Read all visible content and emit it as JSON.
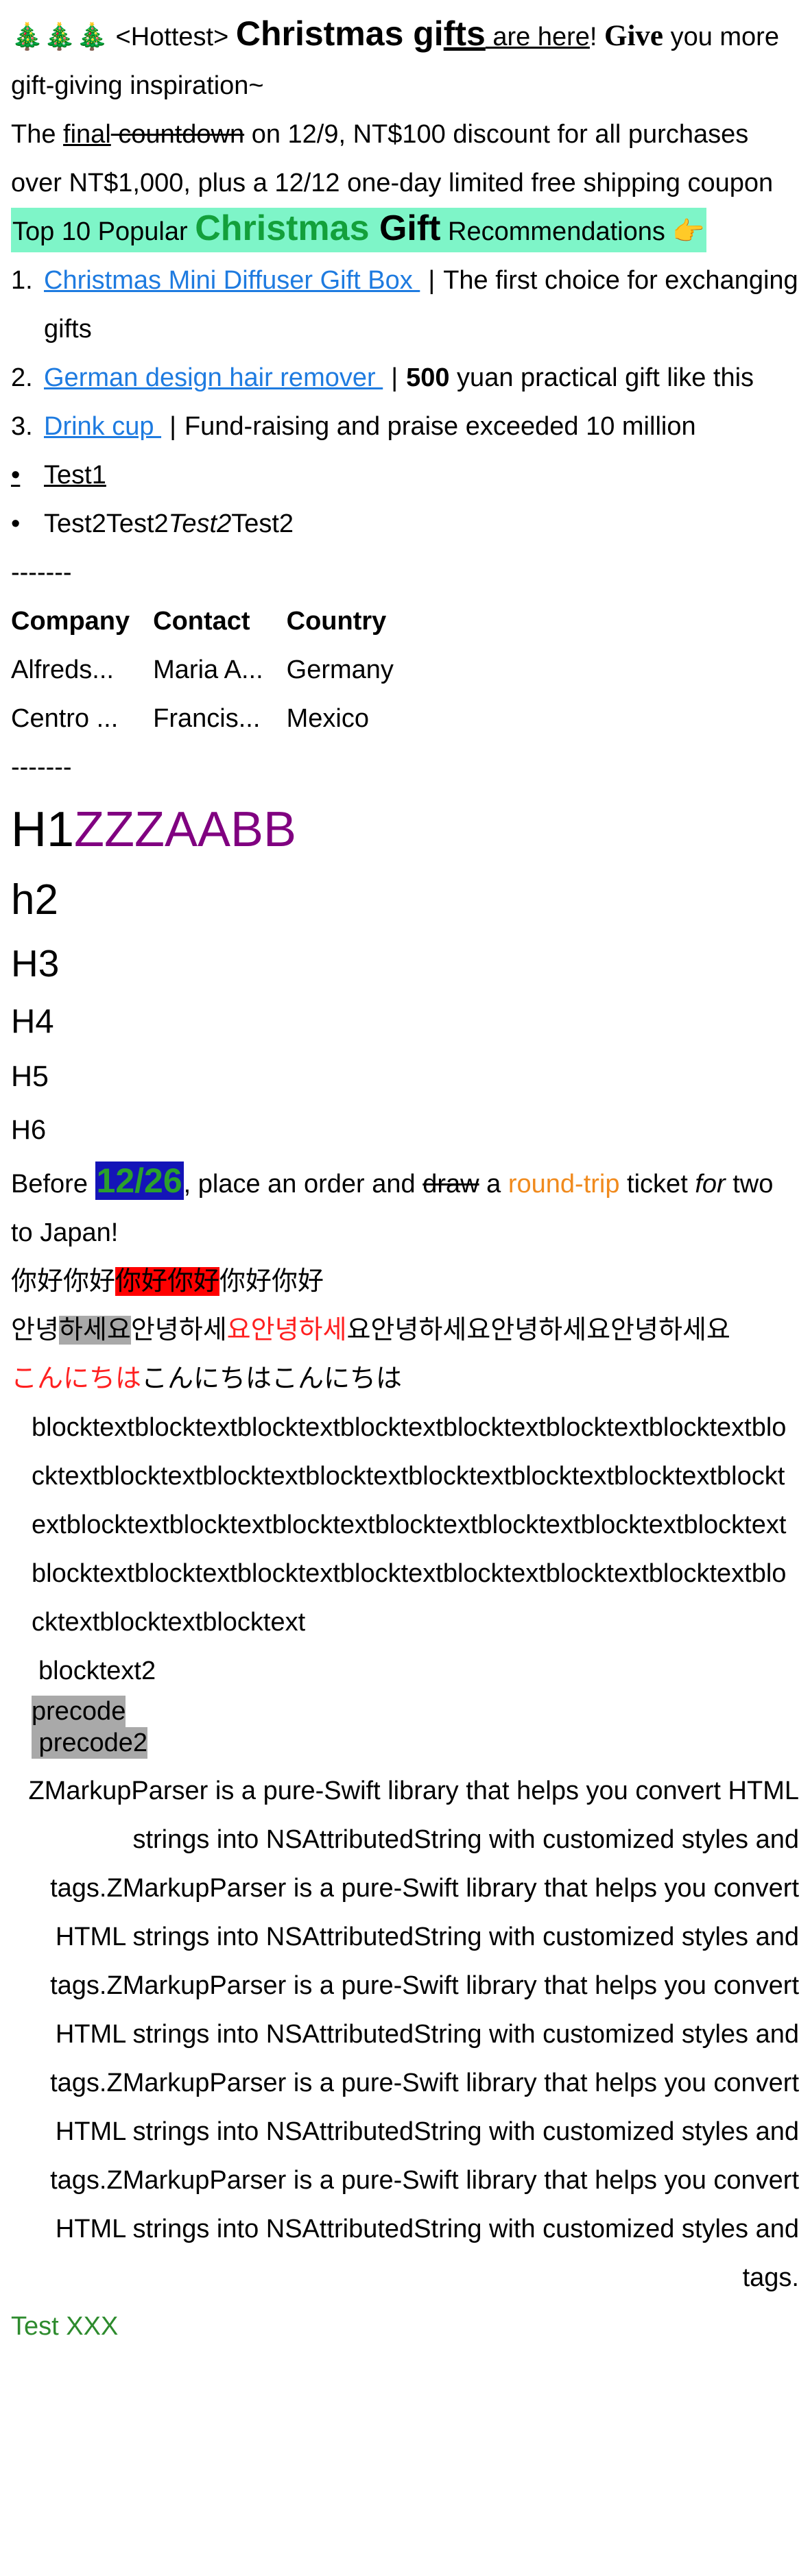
{
  "promo": {
    "trees": "🎄🎄🎄",
    "hottest": " <Hottest> ",
    "christmas": "Christmas gi",
    "fts": "fts",
    "are_here": " are here",
    "bang": "! ",
    "give": "Give",
    "you_more": " you more gift-giving inspiration~"
  },
  "countdown": {
    "the": "The ",
    "final": "final",
    "countdown": " countdown",
    "rest": " on 12/9, NT$100 discount for all purchases over NT$1,000, plus a 12/12 one-day limited free shipping coupon"
  },
  "heading_top10": {
    "prefix": "Top 10 Popular ",
    "christmas": "Christmas",
    "gift": " Gift",
    "suffix": " Recommendations 👉"
  },
  "gifts": [
    {
      "marker": "1.",
      "link": "Christmas Mini Diffuser Gift Box ",
      "sep": "|",
      "desc": "The first choice for exchanging gifts",
      "strong": ""
    },
    {
      "marker": "2.",
      "link": "German design hair remover ",
      "sep": "|",
      "desc": " yuan practical gift like this",
      "strong": "500"
    },
    {
      "marker": "3.",
      "link": "Drink cup ",
      "sep": "|",
      "desc": "Fund-raising and praise exceeded 10 million",
      "strong": ""
    }
  ],
  "tests": [
    {
      "marker": "•",
      "a": "Test1",
      "b": "",
      "c": "",
      "d": ""
    },
    {
      "marker": "•",
      "a": "Test2",
      "b": "Test2",
      "c": "Test2",
      "d": "Test2"
    }
  ],
  "dashes_1": "-------",
  "table": {
    "headers": [
      "Company",
      "Contact",
      "Country"
    ],
    "rows": [
      [
        "Alfreds...",
        "Maria A...",
        "Germany"
      ],
      [
        "Centro ...",
        "Francis...",
        "Mexico"
      ]
    ]
  },
  "dashes_2": "-------",
  "headings": {
    "h1_black": "H1",
    "h1_purple": "ZZZAABB",
    "h2": "h2",
    "h3": "H3",
    "h4": "H4",
    "h5": "H5",
    "h6": "H6"
  },
  "japan": {
    "before": "Before ",
    "date": "12/26",
    "place": ", place an order and ",
    "draw": "draw",
    "a": " a ",
    "roundtrip": "round-trip",
    "ticket": " ticket ",
    "for": "for",
    "two": " two to Japan!"
  },
  "chinese": {
    "a": "你好你好",
    "b": "你好你好",
    "c": "你好你好"
  },
  "korean": {
    "a": "안녕",
    "b": "하세요",
    "c": "안녕하세",
    "d": "요안녕하세",
    "e": "요안녕하세요안녕하세요안녕하세요"
  },
  "japanese": {
    "red": "こんにちは",
    "rest": "こんにちはこんにちは"
  },
  "blocktext": "blocktextblocktextblocktextblocktextblocktextblocktextblocktextblocktextblocktextblocktextblocktextblocktextblocktextblocktextblocktextblocktextblocktextblocktextblocktextblocktextblocktextblocktextblocktextblocktextblocktextblocktextblocktextblocktextblocktextblocktextblocktextblocktext",
  "blocktext2": "blocktext2",
  "precode": "precode",
  "precode2": " precode2",
  "zmarkup": "ZMarkupParser is a pure-Swift library that helps you convert HTML strings into NSAttributedString with customized styles and tags.ZMarkupParser is a pure-Swift library that helps you convert HTML strings into NSAttributedString with customized styles and tags.ZMarkupParser is a pure-Swift library that helps you convert HTML strings into NSAttributedString with customized styles and tags.ZMarkupParser is a pure-Swift library that helps you convert HTML strings into NSAttributedString with customized styles and tags.ZMarkupParser is a pure-Swift library that helps you convert HTML strings into NSAttributedString with customized styles and tags.",
  "footer": "Test XXX",
  "colors": {
    "link": "#1E7BE0",
    "mint": "#7EF5C8",
    "green": "#13A03B",
    "purple": "#800080",
    "date_bg": "#1414B8",
    "orange": "#F08A1D",
    "red": "#FF0000",
    "grey": "#A9A9A9"
  }
}
